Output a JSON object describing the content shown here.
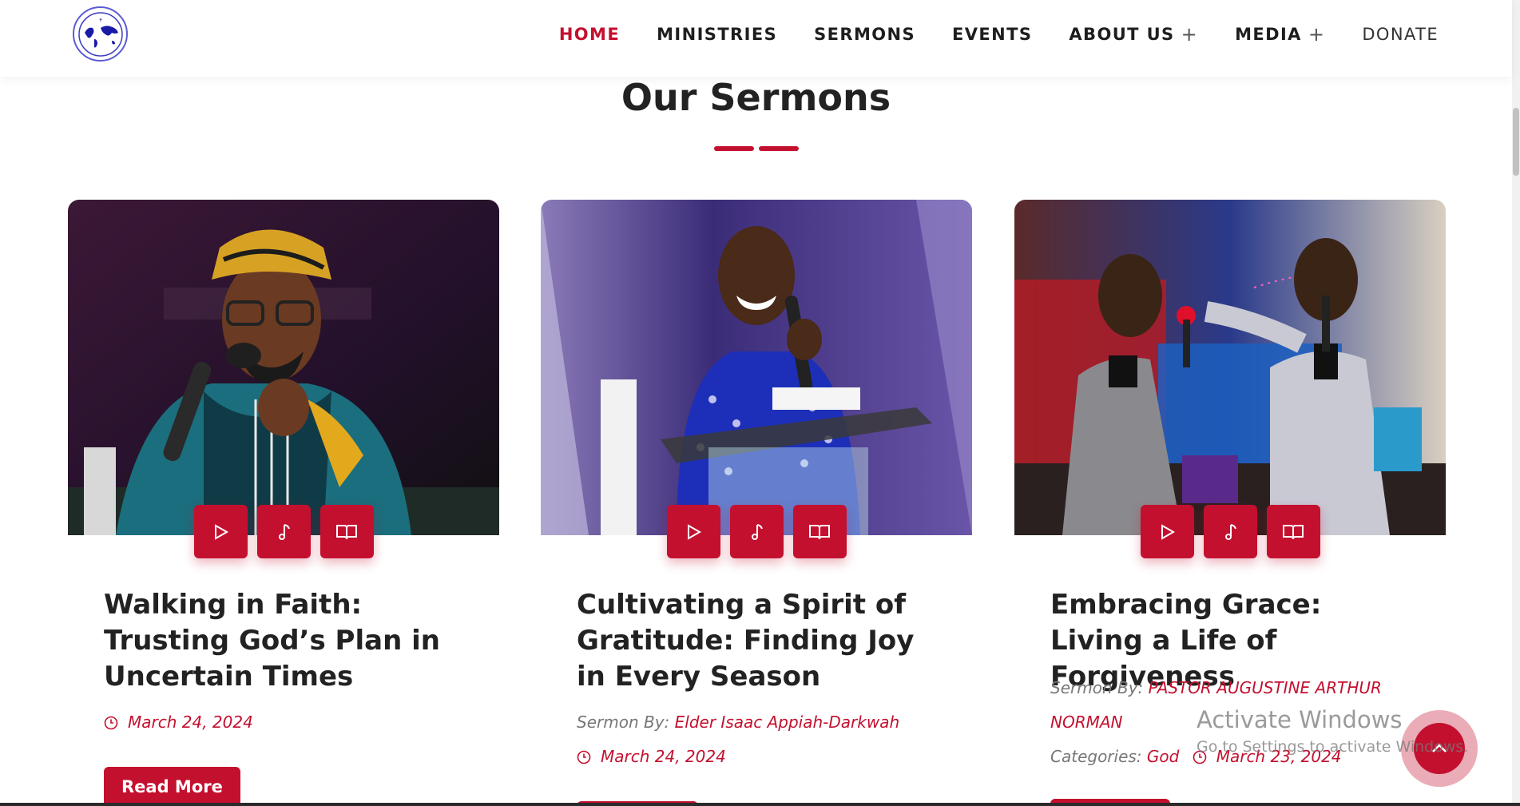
{
  "header": {
    "logo_icon": "globe-logo-icon",
    "nav": [
      {
        "label": "HOME",
        "active": true
      },
      {
        "label": "MINISTRIES"
      },
      {
        "label": "SERMONS"
      },
      {
        "label": "EVENTS"
      },
      {
        "label": "ABOUT US",
        "has_submenu": true,
        "submenu_icon": "plus-icon"
      },
      {
        "label": "MEDIA",
        "has_submenu": true,
        "submenu_icon": "plus-icon"
      },
      {
        "label": "DONATE"
      }
    ]
  },
  "section": {
    "title": "Our Sermons"
  },
  "sermons": [
    {
      "title": "Walking in Faith: Trusting God’s Plan in Uncertain Times",
      "date": "March 24, 2024",
      "read_more": "Read More",
      "media_icons": [
        "play-icon",
        "music-note-icon",
        "book-icon"
      ]
    },
    {
      "title": "Cultivating a Spirit of Gratitude: Finding Joy in Every Season",
      "sermon_by_label": "Sermon By:",
      "preacher": "Elder Isaac Appiah-Darkwah",
      "date": "March 24, 2024",
      "media_icons": [
        "play-icon",
        "music-note-icon",
        "book-icon"
      ]
    },
    {
      "title": "Embracing Grace: Living a Life of Forgiveness",
      "sermon_by_label": "Sermon By:",
      "preacher_line1": "PASTOR AUGUSTINE ARTHUR",
      "preacher_line2": "NORMAN",
      "categories_label": "Categories:",
      "category": "God",
      "date": "March 23, 2024",
      "media_icons": [
        "play-icon",
        "music-note-icon",
        "book-icon"
      ]
    }
  ],
  "watermark": {
    "title": "Activate Windows",
    "subtitle": "Go to Settings to activate Windows."
  },
  "colors": {
    "accent": "#c4102f",
    "text": "#1e1e1e"
  },
  "back_to_top_icon": "chevron-up-icon"
}
